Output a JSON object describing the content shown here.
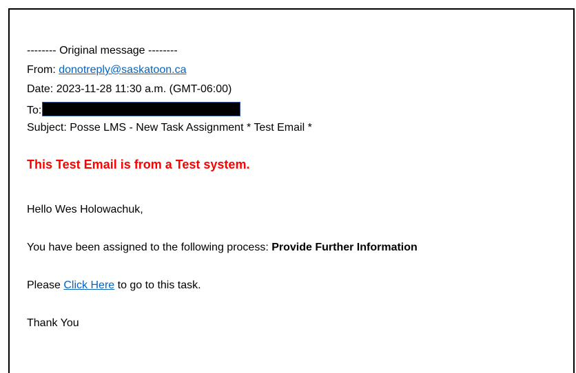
{
  "header": {
    "original_message": "-------- Original message --------",
    "from_label": "From: ",
    "from_email": "donotreply@saskatoon.ca",
    "date": "Date: 2023-11-28 11:30 a.m. (GMT-06:00)",
    "to_label": "To:",
    "subject": "Subject: Posse LMS - New Task Assignment * Test Email *"
  },
  "body": {
    "warning": "This Test Email is from a Test system.",
    "greeting": "Hello Wes Holowachuk,",
    "assigned_prefix": "You have been assigned to the following process: ",
    "process_name": "Provide Further Information",
    "please_prefix": "Please ",
    "click_here": "Click Here",
    "please_suffix": " to go to this task.",
    "closing": "Thank You"
  },
  "colors": {
    "link": "#0563c1",
    "warning": "#ff0000",
    "redaction": "#000000"
  }
}
